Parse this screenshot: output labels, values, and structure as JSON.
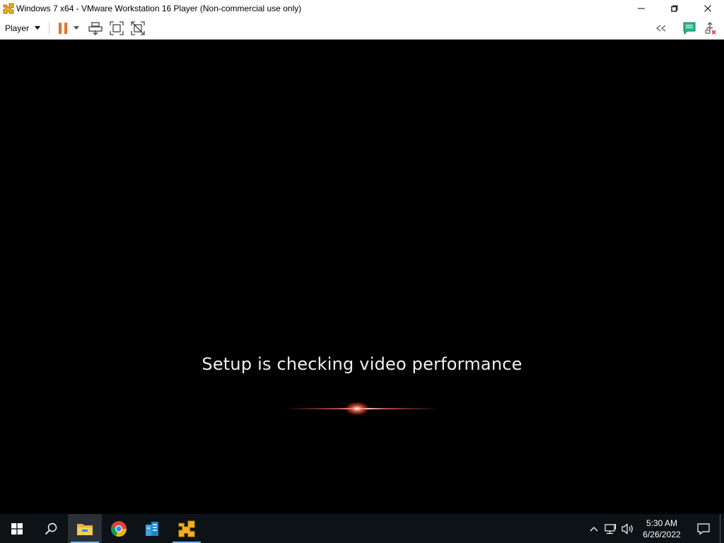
{
  "window": {
    "title": "Windows 7 x64 - VMware Workstation 16 Player (Non-commercial use only)",
    "controls": [
      "minimize",
      "restore",
      "close"
    ]
  },
  "toolbar": {
    "player_menu_label": "Player",
    "buttons": [
      "pause-icon",
      "send-ctrl-alt-del-icon",
      "full-screen-icon",
      "unity-icon"
    ],
    "right_buttons": [
      "collapse-icon",
      "message-log-icon",
      "removable-devices-icon"
    ],
    "accent": "#e8702a"
  },
  "vm": {
    "setup_message": "Setup is checking video performance"
  },
  "taskbar": {
    "apps": [
      "start-icon",
      "search-icon",
      "file-explorer-icon",
      "chrome-icon",
      "server-manager-icon",
      "vmware-player-icon"
    ],
    "clock_time": "5:30 AM",
    "clock_date": "6/26/2022"
  }
}
